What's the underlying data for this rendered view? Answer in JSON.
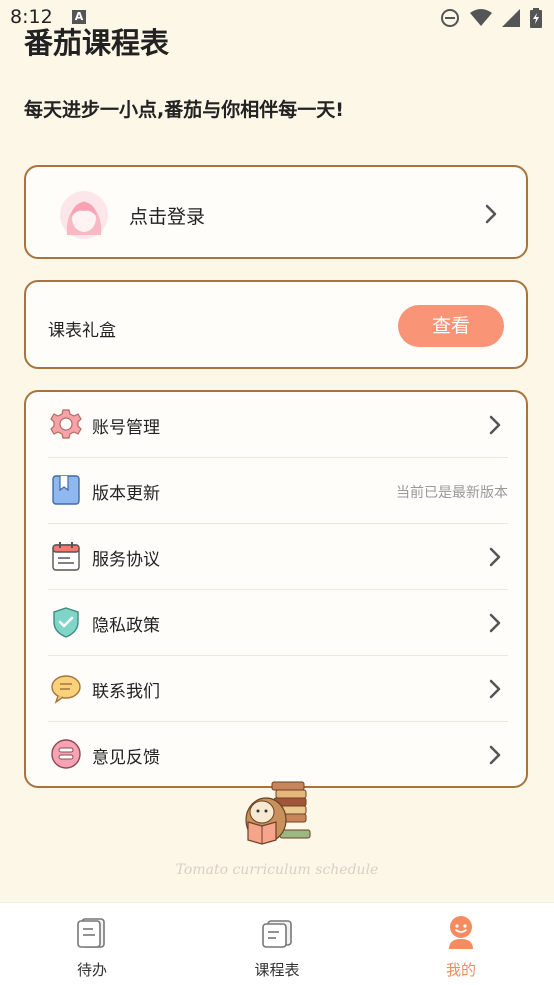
{
  "status_bar": {
    "time": "8:12",
    "notification_icon": "A"
  },
  "app": {
    "title": "番茄课程表",
    "slogan": "每天进步一小点,番茄与你相伴每一天!"
  },
  "login": {
    "label": "点击登录"
  },
  "gift": {
    "label": "课表礼盒",
    "button": "查看"
  },
  "menu": {
    "items": [
      {
        "label": "账号管理",
        "icon": "gear-icon"
      },
      {
        "label": "版本更新",
        "icon": "bookmark-icon",
        "side_text": "当前已是最新版本"
      },
      {
        "label": "服务协议",
        "icon": "calendar-icon"
      },
      {
        "label": "隐私政策",
        "icon": "shield-check-icon"
      },
      {
        "label": "联系我们",
        "icon": "chat-bubble-icon"
      },
      {
        "label": "意见反馈",
        "icon": "feedback-icon"
      }
    ]
  },
  "footer": {
    "tagline": "Tomato curriculum schedule"
  },
  "tabs": [
    {
      "label": "待办",
      "icon": "todo-icon",
      "active": false
    },
    {
      "label": "课程表",
      "icon": "schedule-icon",
      "active": false
    },
    {
      "label": "我的",
      "icon": "profile-icon",
      "active": true
    }
  ],
  "colors": {
    "background": "#fdf7e8",
    "card_border": "#a8743c",
    "accent": "#f99476",
    "active_tab": "#f58b5e"
  }
}
